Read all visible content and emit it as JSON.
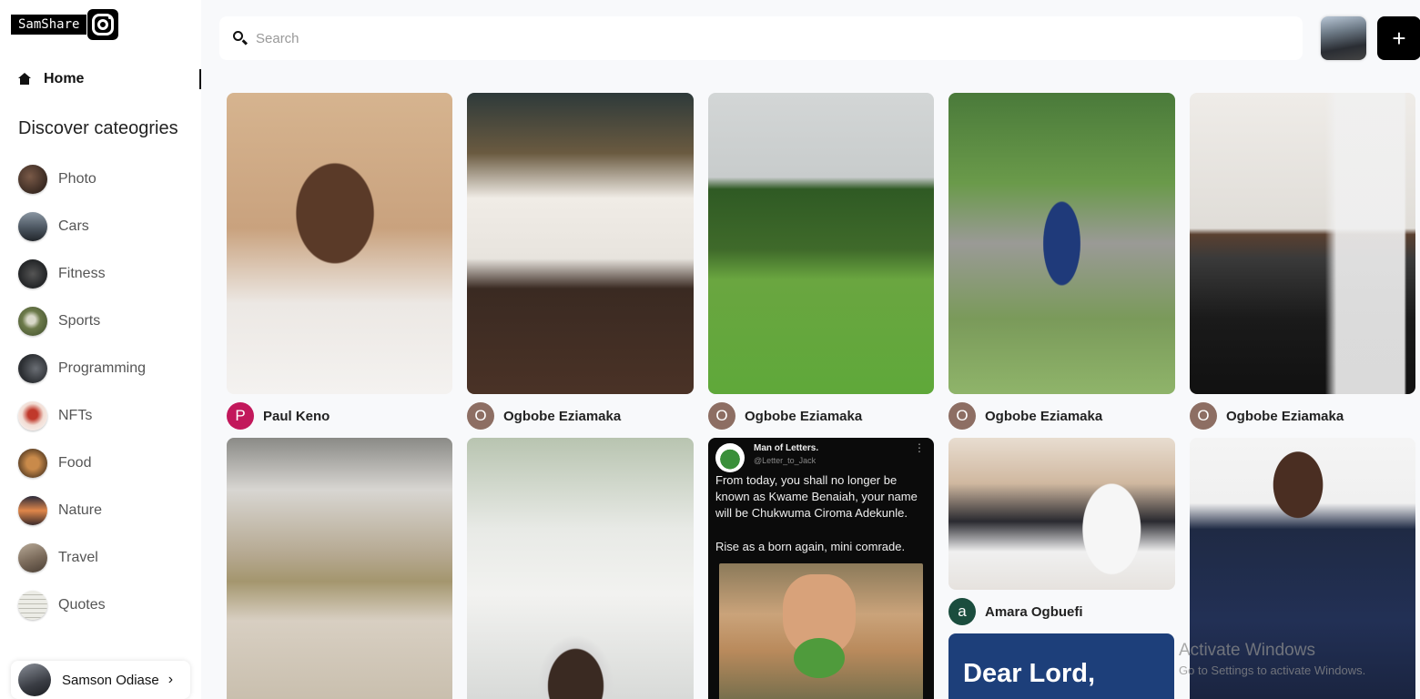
{
  "brand": {
    "name": "SamShare"
  },
  "nav": {
    "home_label": "Home"
  },
  "discover": {
    "title": "Discover cateogries",
    "items": [
      {
        "label": "Photo",
        "color": "#3a2a22"
      },
      {
        "label": "Cars",
        "color": "#4b5560"
      },
      {
        "label": "Fitness",
        "color": "#222426"
      },
      {
        "label": "Sports",
        "color": "#6c7a4a"
      },
      {
        "label": "Programming",
        "color": "#2c2f33"
      },
      {
        "label": "NFTs",
        "color": "#d9a58f"
      },
      {
        "label": "Food",
        "color": "#6b4a2a"
      },
      {
        "label": "Nature",
        "color": "#b8623a"
      },
      {
        "label": "Travel",
        "color": "#7a6a5a"
      },
      {
        "label": "Quotes",
        "color": "#d8d8d0"
      }
    ]
  },
  "user": {
    "name": "Samson Odiase",
    "chevron": "chevron-right-icon"
  },
  "search": {
    "placeholder": "Search"
  },
  "actions": {
    "add_label": "+"
  },
  "feed": {
    "row1": [
      {
        "author": "Paul Keno",
        "initial": "P",
        "avatar_color": "#c2185b",
        "image_colors": [
          "#c9a27e",
          "#6b4a36",
          "#e8e4e0"
        ]
      },
      {
        "author": "Ogbobe Eziamaka",
        "initial": "O",
        "avatar_color": "#8d6e63",
        "image_colors": [
          "#3a2e26",
          "#f0ece6",
          "#5a4230"
        ]
      },
      {
        "author": "Ogbobe Eziamaka",
        "initial": "O",
        "avatar_color": "#8d6e63",
        "image_colors": [
          "#cfd3d4",
          "#3f6a2a",
          "#5fa83a"
        ]
      },
      {
        "author": "Ogbobe Eziamaka",
        "initial": "O",
        "avatar_color": "#8d6e63",
        "image_colors": [
          "#4a7a3a",
          "#9a9a96",
          "#8fb46a"
        ]
      },
      {
        "author": "Ogbobe Eziamaka",
        "initial": "O",
        "avatar_color": "#8d6e63",
        "image_colors": [
          "#e8e6e2",
          "#3a3a3a",
          "#111111"
        ]
      }
    ],
    "wedding": {
      "author": "Amara Ogbuefi",
      "initial": "a",
      "avatar_color": "#1b4d3e"
    },
    "tweet": {
      "name": "Man of Letters.",
      "handle": "@Letter_to_Jack",
      "text": "From today, you shall no longer be known as Kwame Benaiah, your name will be Chukwuma Ciroma Adekunle.",
      "text2": "Rise as a born again, mini comrade."
    },
    "quote_card": {
      "text": "Dear Lord,"
    }
  },
  "watermark": {
    "line1": "Activate Windows",
    "line2": "Go to Settings to activate Windows."
  }
}
